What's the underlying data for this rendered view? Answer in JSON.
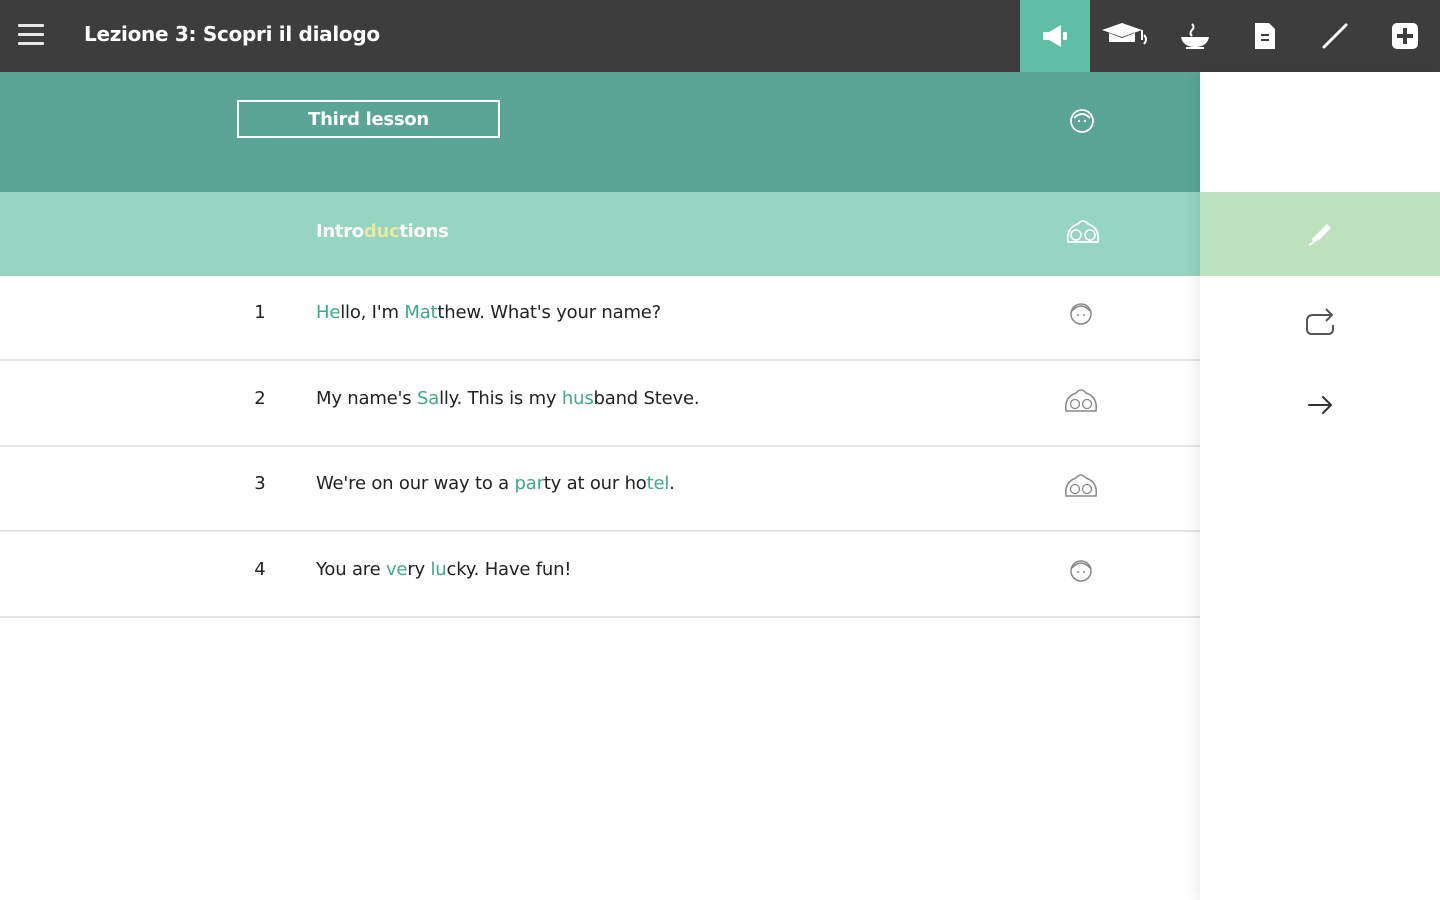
{
  "app": {
    "title": "Lezione 3: Scopri il dialogo"
  },
  "toolbar": {
    "tools": [
      {
        "icon": "megaphone-icon",
        "active": true
      },
      {
        "icon": "graduation-cap-icon",
        "active": false
      },
      {
        "icon": "bowl-icon",
        "active": false
      },
      {
        "icon": "document-icon",
        "active": false
      },
      {
        "icon": "pencil-icon",
        "active": false
      },
      {
        "icon": "plus-square-icon",
        "active": false
      }
    ]
  },
  "lesson": {
    "label": "Third lesson",
    "section_title_parts": [
      {
        "text": "Intro",
        "hl": false
      },
      {
        "text": "duc",
        "hl": "yellow"
      },
      {
        "text": "tions",
        "hl": false
      }
    ]
  },
  "dialog": [
    {
      "num": "1",
      "speaker": "man-face-icon",
      "parts": [
        {
          "text": "He",
          "hl": true
        },
        {
          "text": "llo, I'm ",
          "hl": false
        },
        {
          "text": "Mat",
          "hl": true
        },
        {
          "text": "thew. What's your name?",
          "hl": false
        }
      ]
    },
    {
      "num": "2",
      "speaker": "woman-face-icon",
      "parts": [
        {
          "text": "My name's ",
          "hl": false
        },
        {
          "text": "Sa",
          "hl": true
        },
        {
          "text": "lly. This is my ",
          "hl": false
        },
        {
          "text": "hus",
          "hl": true
        },
        {
          "text": "band Steve.",
          "hl": false
        }
      ]
    },
    {
      "num": "3",
      "speaker": "woman-face-icon",
      "parts": [
        {
          "text": "We're on our way to a ",
          "hl": false
        },
        {
          "text": "par",
          "hl": true
        },
        {
          "text": "ty at our ho",
          "hl": false
        },
        {
          "text": "tel",
          "hl": true
        },
        {
          "text": ".",
          "hl": false
        }
      ]
    },
    {
      "num": "4",
      "speaker": "man-face-icon",
      "parts": [
        {
          "text": "You are ",
          "hl": false
        },
        {
          "text": "ve",
          "hl": true
        },
        {
          "text": "ry ",
          "hl": false
        },
        {
          "text": "lu",
          "hl": true
        },
        {
          "text": "cky. Have fun!",
          "hl": false
        }
      ]
    }
  ],
  "side": {
    "buttons": [
      "highlighter-icon",
      "repeat-icon",
      "arrow-right-icon"
    ]
  },
  "colors": {
    "topbar": "#3d3d3d",
    "accent": "#5fbfa6",
    "header": "#5aa596",
    "section": "#96d5c2",
    "highlight_text": "#3ea98d",
    "side_active": "#bde0bd"
  }
}
